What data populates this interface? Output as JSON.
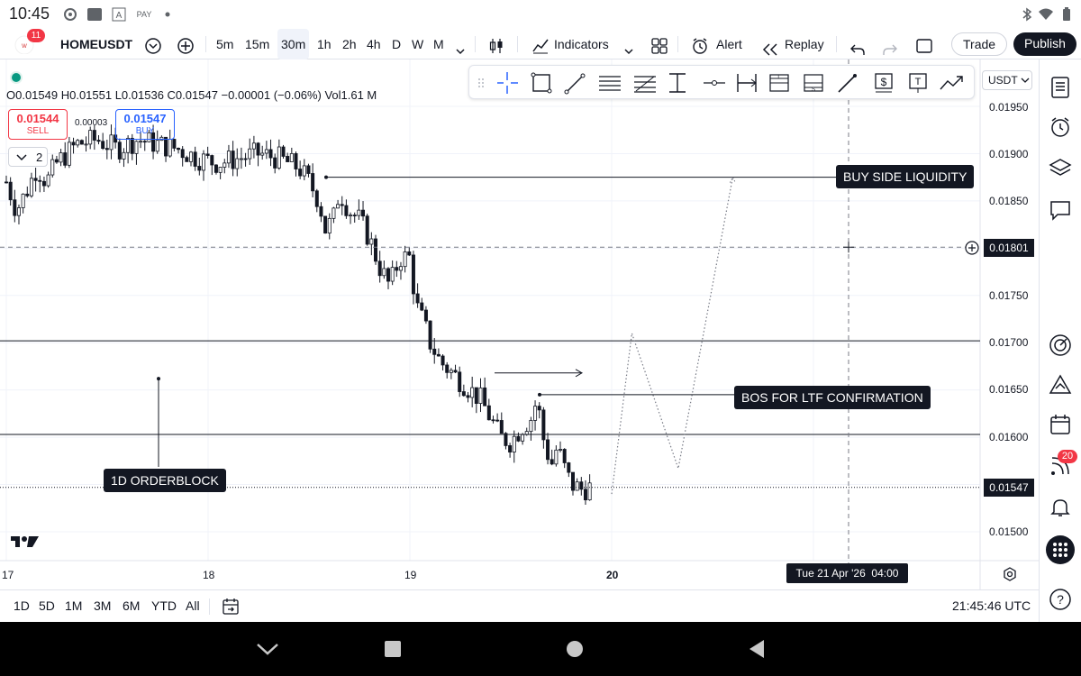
{
  "status": {
    "time": "10:45",
    "icons": [
      "camera-icon",
      "photo-icon",
      "a-icon",
      "pay-icon",
      "dot-icon"
    ],
    "right_icons": [
      "bluetooth-icon",
      "wifi-icon",
      "battery-icon"
    ]
  },
  "topbar": {
    "badge": "11",
    "symbol": "HOMEUSDT",
    "timeframes": [
      "5m",
      "15m",
      "30m",
      "1h",
      "2h",
      "4h",
      "D",
      "W",
      "M"
    ],
    "active_timeframe": "30m",
    "indicators_label": "Indicators",
    "alert_label": "Alert",
    "replay_label": "Replay",
    "trade_label": "Trade",
    "publish_label": "Publish"
  },
  "legend": {
    "ohlc": "O0.01549 H0.01551 L0.01536 C0.01547 −0.00001 (−0.06%) Vol1.61 M",
    "sell_price": "0.01544",
    "sell_label": "SELL",
    "spread": "0.00003",
    "buy_price": "0.01547",
    "buy_label": "BUY",
    "collapse_count": "2"
  },
  "axis": {
    "currency": "USDT",
    "y_ticks": [
      "0.01950",
      "0.01900",
      "0.01850",
      "0.01750",
      "0.01700",
      "0.01650",
      "0.01600",
      "0.01500"
    ],
    "crosshair_price": "0.01801",
    "last_price": "0.01547",
    "x_ticks": [
      "17",
      "18",
      "19",
      "20"
    ],
    "crosshair_time": "Tue 21 Apr '26  04:00"
  },
  "annotations": {
    "buy_side": "BUY SIDE LIQUIDITY",
    "bos": "BOS FOR LTF CONFIRMATION",
    "orderblock": "1D ORDERBLOCK"
  },
  "bottombar": {
    "ranges": [
      "1D",
      "5D",
      "1M",
      "3M",
      "6M",
      "YTD",
      "All"
    ],
    "clock": "21:45:46 UTC"
  },
  "rightbar": {
    "notification_count": "20"
  },
  "colors": {
    "up": "#131722",
    "down": "#131722",
    "accent": "#2962ff",
    "sell": "#f23645"
  },
  "chart_data": {
    "type": "candlestick",
    "symbol": "HOMEUSDT",
    "interval": "30m",
    "levels": [
      0.01875,
      0.01702,
      0.01603,
      0.01547
    ],
    "projection_path": [
      [
        20.0,
        0.0154
      ],
      [
        20.1,
        0.0171
      ],
      [
        20.33,
        0.01567
      ],
      [
        20.6,
        0.01875
      ]
    ],
    "price_path": [
      [
        17.0,
        0.0187
      ],
      [
        17.05,
        0.0184
      ],
      [
        17.1,
        0.0186
      ],
      [
        17.15,
        0.01885
      ],
      [
        17.2,
        0.0187
      ],
      [
        17.25,
        0.0189
      ],
      [
        17.3,
        0.019
      ],
      [
        17.35,
        0.0191
      ],
      [
        17.45,
        0.01915
      ],
      [
        17.55,
        0.01905
      ],
      [
        17.65,
        0.01915
      ],
      [
        17.75,
        0.0191
      ],
      [
        17.85,
        0.01905
      ],
      [
        17.95,
        0.01895
      ],
      [
        18.05,
        0.0189
      ],
      [
        18.15,
        0.01895
      ],
      [
        18.25,
        0.019
      ],
      [
        18.35,
        0.01895
      ],
      [
        18.45,
        0.01885
      ],
      [
        18.5,
        0.0187
      ],
      [
        18.55,
        0.0185
      ],
      [
        18.58,
        0.0182
      ],
      [
        18.62,
        0.0183
      ],
      [
        18.65,
        0.0186
      ],
      [
        18.7,
        0.0184
      ],
      [
        18.75,
        0.0183
      ],
      [
        18.8,
        0.0181
      ],
      [
        18.85,
        0.0178
      ],
      [
        18.9,
        0.0176
      ],
      [
        18.95,
        0.0179
      ],
      [
        19.0,
        0.0179
      ],
      [
        19.03,
        0.0174
      ],
      [
        19.07,
        0.0172
      ],
      [
        19.1,
        0.017
      ],
      [
        19.15,
        0.0168
      ],
      [
        19.2,
        0.0167
      ],
      [
        19.25,
        0.0166
      ],
      [
        19.3,
        0.0165
      ],
      [
        19.35,
        0.0164
      ],
      [
        19.4,
        0.0162
      ],
      [
        19.45,
        0.016
      ],
      [
        19.5,
        0.01595
      ],
      [
        19.55,
        0.0161
      ],
      [
        19.6,
        0.0162
      ],
      [
        19.63,
        0.0164
      ],
      [
        19.66,
        0.016
      ],
      [
        19.7,
        0.0157
      ],
      [
        19.73,
        0.0159
      ],
      [
        19.77,
        0.01565
      ],
      [
        19.8,
        0.0155
      ],
      [
        19.85,
        0.01545
      ],
      [
        19.9,
        0.01547
      ]
    ],
    "y_range": [
      0.0148,
      0.0198
    ]
  }
}
